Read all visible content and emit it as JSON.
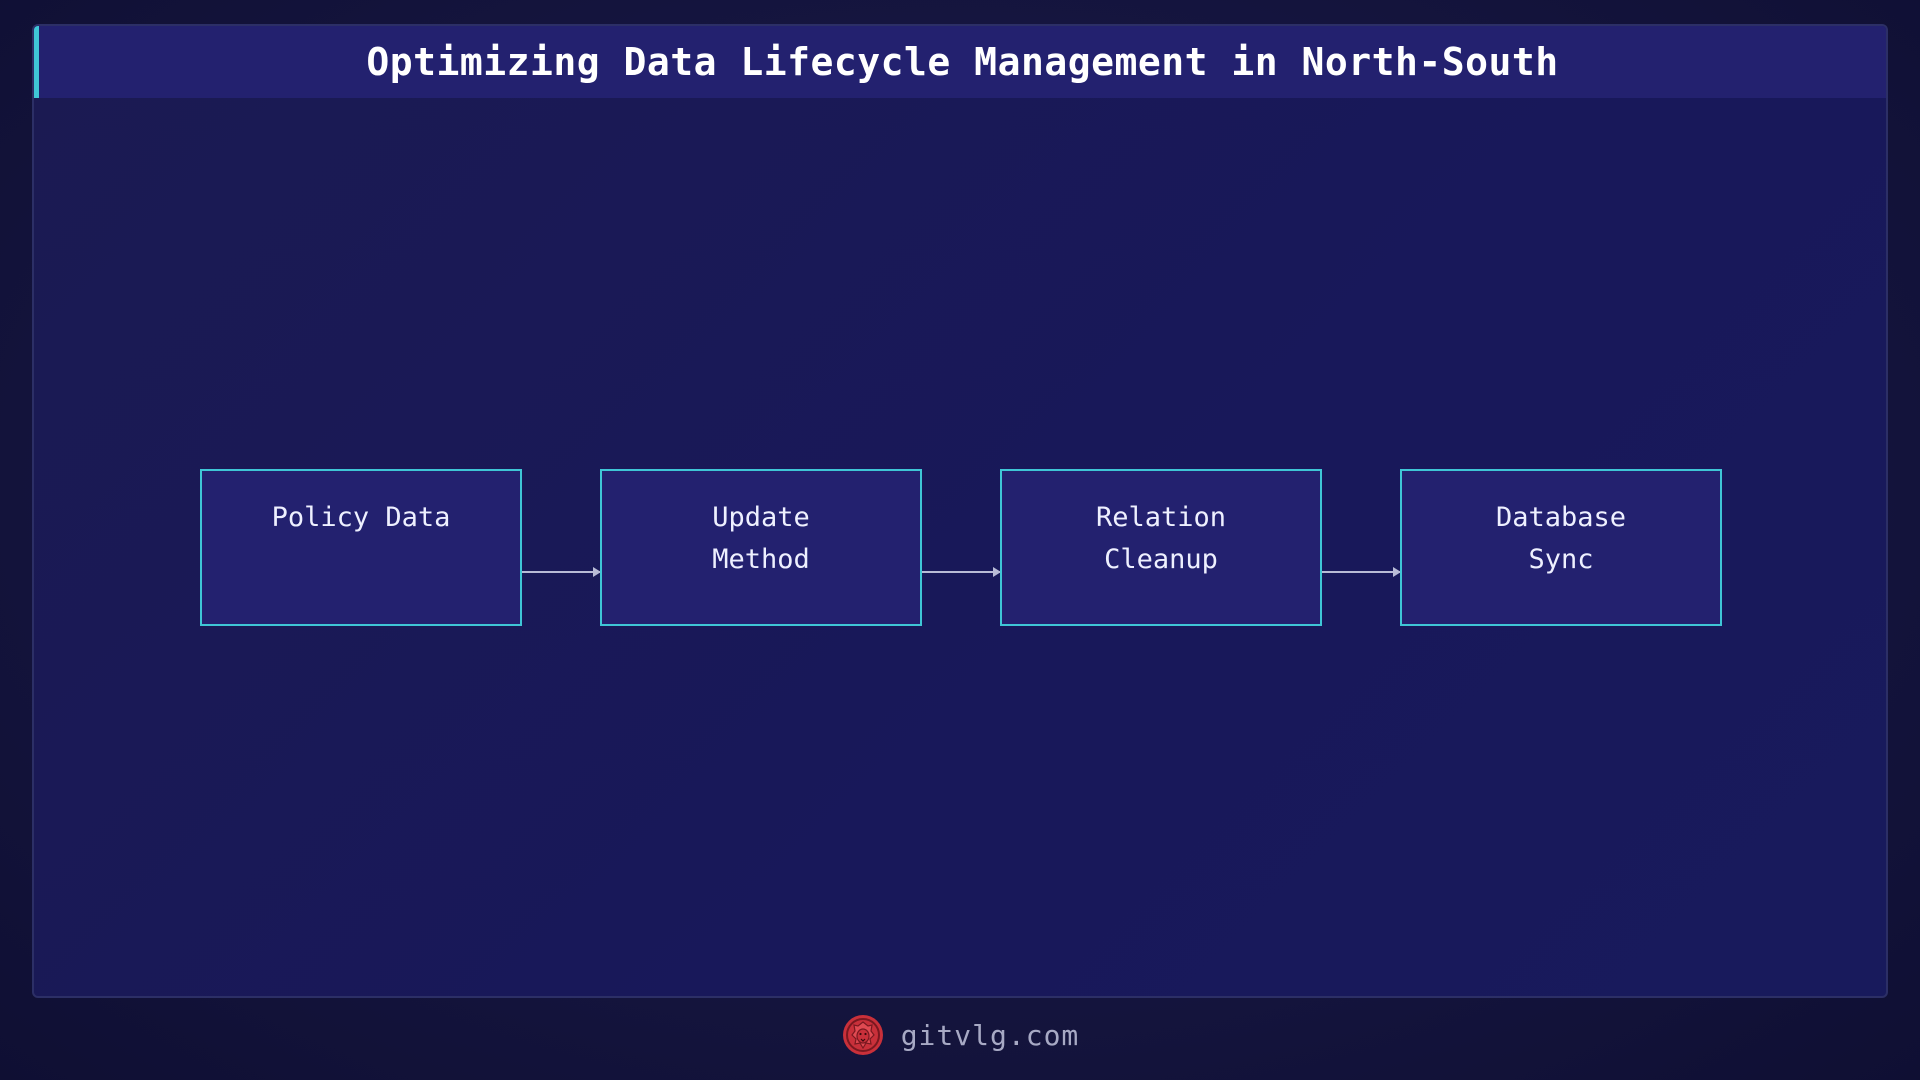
{
  "header": {
    "title": "Optimizing Data Lifecycle Management in North-South"
  },
  "diagram": {
    "nodes": [
      {
        "lines": [
          "Policy Data"
        ]
      },
      {
        "lines": [
          "Update",
          "Method"
        ]
      },
      {
        "lines": [
          "Relation",
          "Cleanup"
        ]
      },
      {
        "lines": [
          "Database",
          "Sync"
        ]
      }
    ]
  },
  "footer": {
    "site": "gitvlg.com",
    "logo_icon": "lion-head-icon"
  },
  "colors": {
    "accent": "#3fc6d6",
    "node_fill": "#23216f",
    "logo": "#c9303a"
  }
}
